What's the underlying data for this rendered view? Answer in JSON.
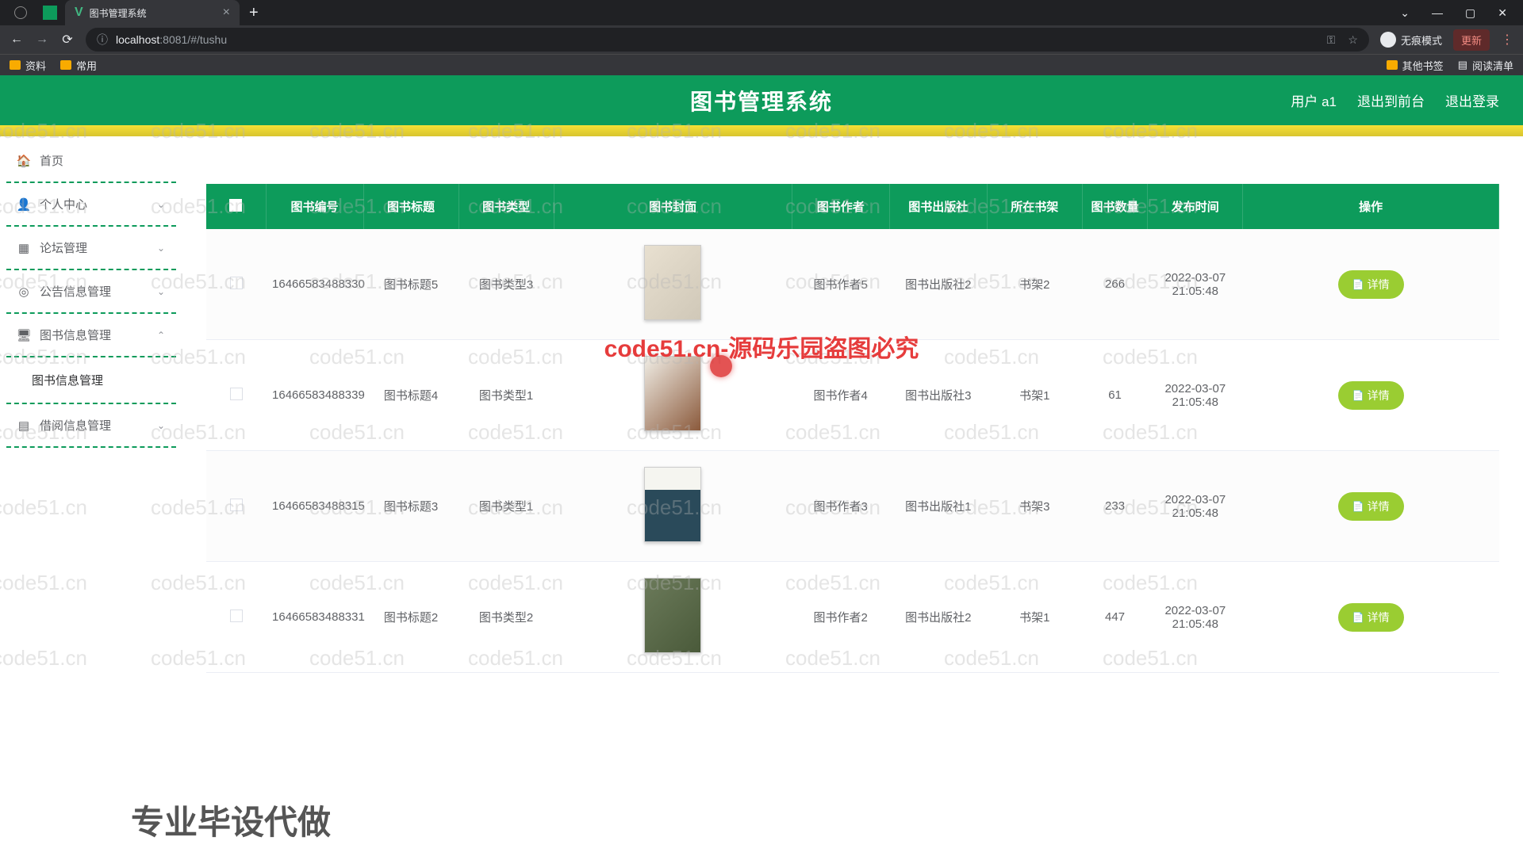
{
  "browser": {
    "tab_title": "图书管理系统",
    "url_host": "localhost",
    "url_port_path": ":8081/#/tushu",
    "incognito_label": "无痕模式",
    "update_label": "更新",
    "bookmarks": {
      "b1": "资料",
      "b2": "常用",
      "other": "其他书签",
      "reading": "阅读清单"
    }
  },
  "header": {
    "title": "图书管理系统",
    "user_label": "用户 a1",
    "to_front": "退出到前台",
    "logout": "退出登录"
  },
  "sidebar": {
    "home": "首页",
    "personal": "个人中心",
    "forum": "论坛管理",
    "notice": "公告信息管理",
    "book": "图书信息管理",
    "book_sub": "图书信息管理",
    "borrow": "借阅信息管理"
  },
  "table": {
    "headers": {
      "id": "图书编号",
      "title": "图书标题",
      "type": "图书类型",
      "cover": "图书封面",
      "author": "图书作者",
      "publisher": "图书出版社",
      "shelf": "所在书架",
      "qty": "图书数量",
      "date": "发布时间",
      "op": "操作"
    },
    "detail_label": "详情",
    "rows": [
      {
        "id": "16466583488330",
        "title": "图书标题5",
        "type": "图书类型3",
        "author": "图书作者5",
        "publisher": "图书出版社2",
        "shelf": "书架2",
        "qty": "266",
        "date": "2022-03-07 21:05:48"
      },
      {
        "id": "16466583488339",
        "title": "图书标题4",
        "type": "图书类型1",
        "author": "图书作者4",
        "publisher": "图书出版社3",
        "shelf": "书架1",
        "qty": "61",
        "date": "2022-03-07 21:05:48"
      },
      {
        "id": "16466583488315",
        "title": "图书标题3",
        "type": "图书类型1",
        "author": "图书作者3",
        "publisher": "图书出版社1",
        "shelf": "书架3",
        "qty": "233",
        "date": "2022-03-07 21:05:48"
      },
      {
        "id": "16466583488331",
        "title": "图书标题2",
        "type": "图书类型2",
        "author": "图书作者2",
        "publisher": "图书出版社2",
        "shelf": "书架1",
        "qty": "447",
        "date": "2022-03-07 21:05:48"
      }
    ]
  },
  "overlay": {
    "watermark": "code51.cn",
    "red_text": "code51.cn-源码乐园盗图必究",
    "bottom": "专业毕设代做"
  }
}
